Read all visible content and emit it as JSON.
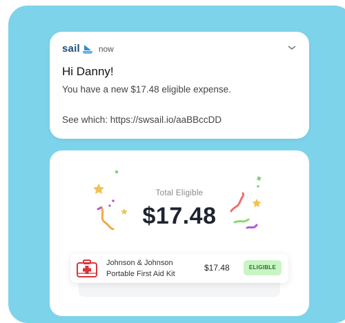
{
  "notification": {
    "app_name": "sail",
    "time": "now",
    "greeting": "Hi Danny!",
    "message": "You have a new $17.48 eligible expense.",
    "link_line": "See which: https://swsail.io/aaBBccDD",
    "icons": {
      "brand": "sail-logo-icon",
      "expand": "chevron-down-icon"
    }
  },
  "summary": {
    "total_label": "Total Eligible",
    "total_amount": "$17.48"
  },
  "expense_item": {
    "name_line1": "Johnson & Johnson",
    "name_line2": "Portable First Aid Kit",
    "price": "$17.48",
    "status": "ELIGIBLE",
    "icon": "first-aid-kit-icon"
  },
  "colors": {
    "background": "#7dd3ea",
    "badge_bg": "#c8f5c4",
    "badge_text": "#2d6b2a",
    "kit_red": "#d9343a"
  }
}
